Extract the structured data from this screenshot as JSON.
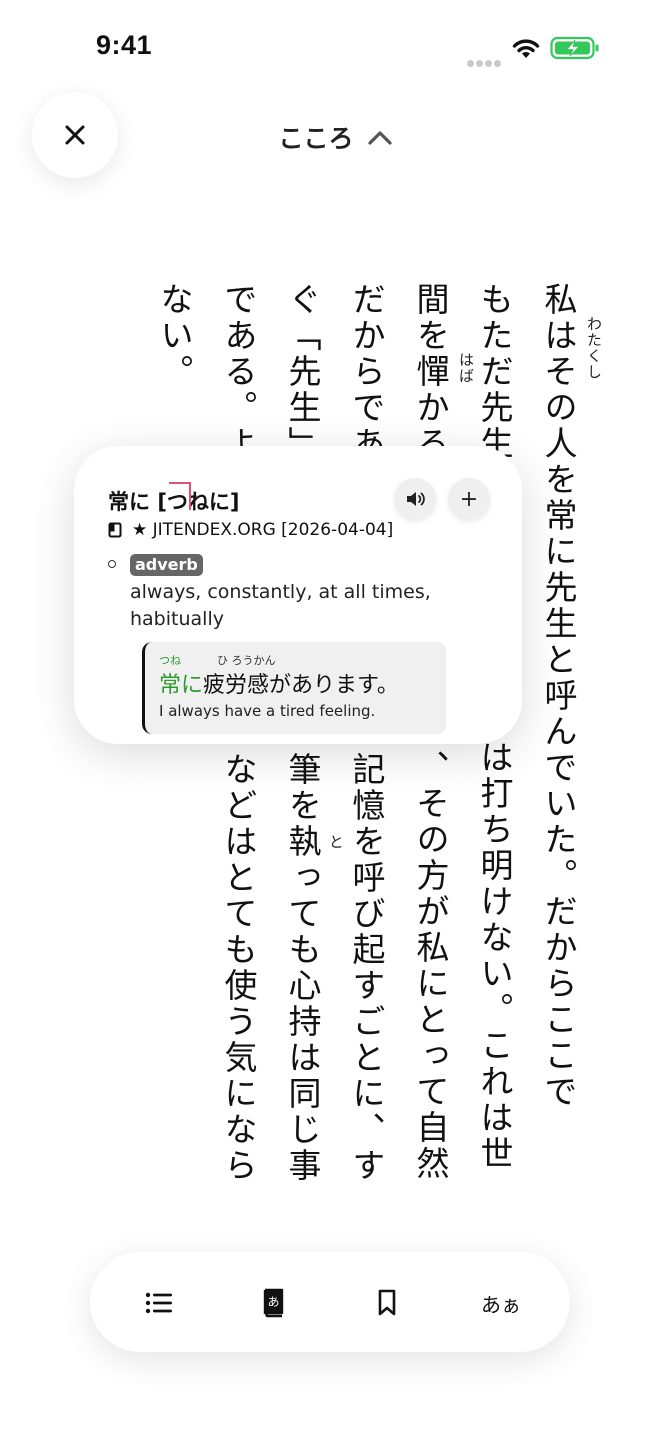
{
  "status_bar": {
    "time": "9:41"
  },
  "header": {
    "book_title": "こころ"
  },
  "reader": {
    "columns": [
      "私はその人を常に先生と呼んでいた。だからここで",
      "もただ先生",
      "間を憚かる",
      "だからであ",
      "ぐ「先生」",
      "である。よ",
      "ない。"
    ],
    "lower_columns": [
      "は打ち明けない。これは世",
      "、その方が私にとって自然",
      "記憶を呼び起すごとに、す",
      "筆を執っても心持は同じ事",
      "などはとても使う気になら"
    ],
    "ruby": {
      "watakushi": "わたくし",
      "haba": "はば",
      "to": "と"
    }
  },
  "popup": {
    "headword_kanji": "常に",
    "headword_reading_open": "[",
    "headword_reading_a": "つ",
    "headword_reading_b": "ねに",
    "headword_reading_close": "]",
    "add_label": "+",
    "source": "★ JITENDEX.ORG [2026-04-04]",
    "part_of_speech": "adverb",
    "gloss": "always, constantly, at all times, habitually",
    "example": {
      "ruby_tsune": "つね",
      "ruby_hirou": "ひ ろうかん",
      "highlight": "常に",
      "rest": "疲労感があります。",
      "translation": "I always have a tired feeling."
    }
  },
  "toolbar": {
    "font_label": "あぁ"
  }
}
